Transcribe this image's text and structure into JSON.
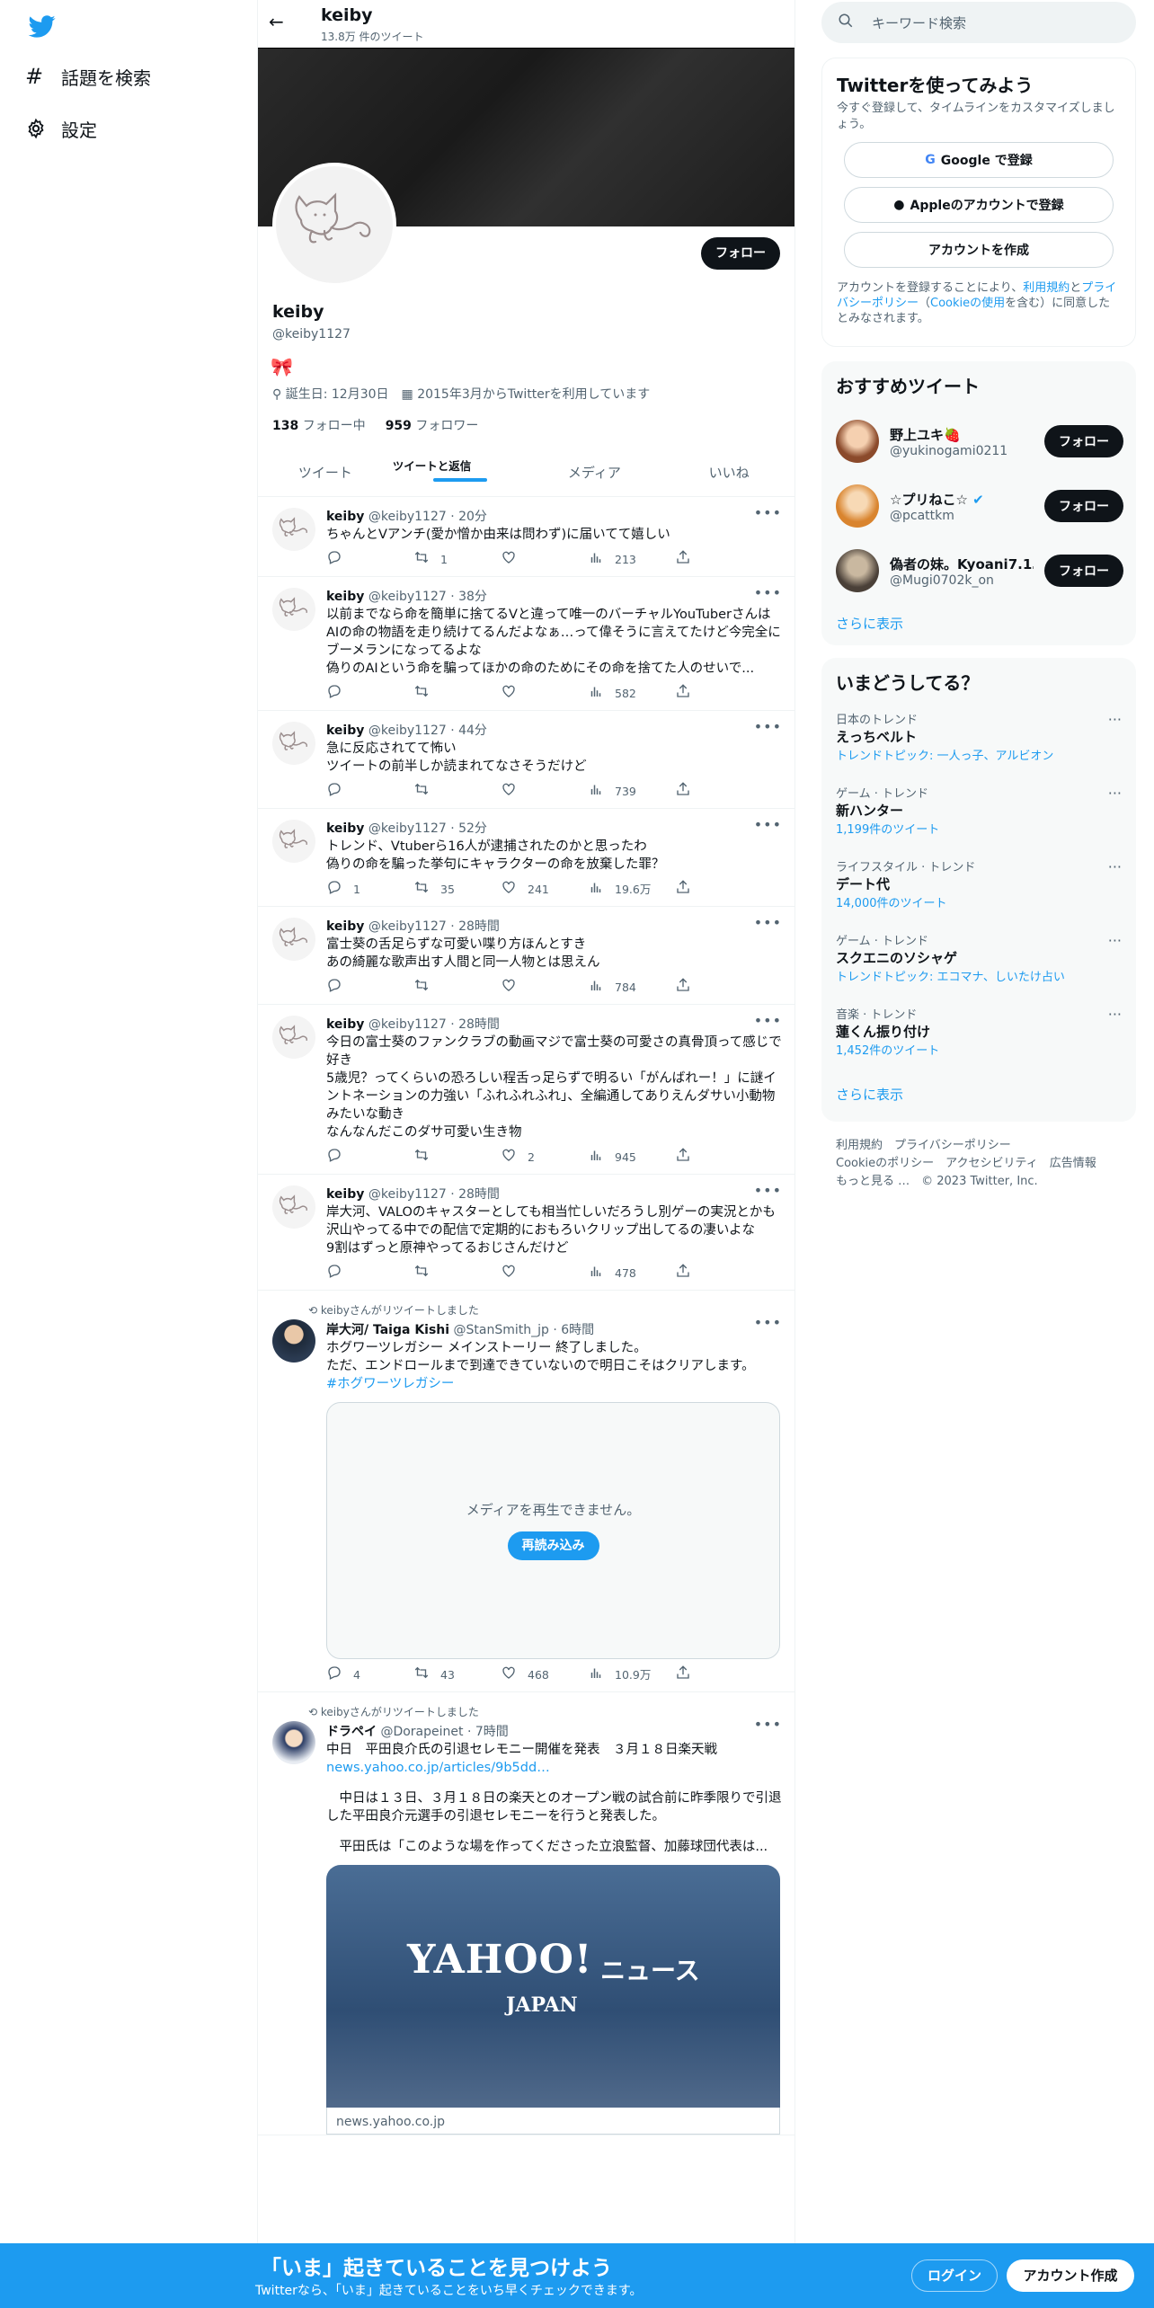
{
  "nav": {
    "explore": "話題を検索",
    "settings": "設定"
  },
  "header": {
    "title": "keiby",
    "tweet_count": "13.8万 件のツイート"
  },
  "profile": {
    "follow": "フォロー",
    "name": "keiby",
    "handle": "@keiby1127",
    "birthday": "誕生日: 12月30日",
    "joined": "2015年3月からTwitterを利用しています",
    "following_num": "138",
    "following_label": "フォロー中",
    "followers_num": "959",
    "followers_label": "フォロワー"
  },
  "tabs": [
    "ツイート",
    "ツイートと返信",
    "メディア",
    "いいね"
  ],
  "tweets": [
    {
      "name": "keiby",
      "meta": "@keiby1127 · 20分",
      "text": "ちゃんとVアンチ(愛か憎か由来は問わず)に届いてて嬉しい",
      "reply": "",
      "rt": "1",
      "like": "",
      "views": "213"
    },
    {
      "name": "keiby",
      "meta": "@keiby1127 · 38分",
      "text": "以前までなら命を簡単に捨てるVと違って唯一のバーチャルYouTuberさんはAIの命の物語を走り続けてるんだよなぁ…って偉そうに言えてたけど今完全にブーメランになってるよな\n偽りのAIという命を騙ってほかの命のためにその命を捨てた人のせいで...",
      "reply": "",
      "rt": "",
      "like": "",
      "views": "582"
    },
    {
      "name": "keiby",
      "meta": "@keiby1127 · 44分",
      "text": "急に反応されてて怖い\nツイートの前半しか読まれてなさそうだけど",
      "reply": "",
      "rt": "",
      "like": "",
      "views": "739"
    },
    {
      "name": "keiby",
      "meta": "@keiby1127 · 52分",
      "text": "トレンド、Vtuberら16人が逮捕されたのかと思ったわ\n偽りの命を騙った挙句にキャラクターの命を放棄した罪？",
      "reply": "1",
      "rt": "35",
      "like": "241",
      "views": "19.6万"
    },
    {
      "name": "keiby",
      "meta": "@keiby1127 · 28時間",
      "text": "富士葵の舌足らずな可愛い喋り方ほんとすき\nあの綺麗な歌声出す人間と同一人物とは思えん",
      "reply": "",
      "rt": "",
      "like": "",
      "views": "784"
    },
    {
      "name": "keiby",
      "meta": "@keiby1127 · 28時間",
      "text": "今日の富士葵のファンクラブの動画マジで富士葵の可愛さの真骨頂って感じで好き\n5歳児？ってくらいの恐ろしい程舌っ足らずで明るい「がんばれー！」に謎イントネーションの力強い「ふれふれふれ」、全編通してありえんダサい小動物みたいな動き\nなんなんだこのダサ可愛い生き物",
      "reply": "",
      "rt": "",
      "like": "2",
      "views": "945"
    },
    {
      "name": "keiby",
      "meta": "@keiby1127 · 28時間",
      "text": "岸大河、VALOのキャスターとしても相当忙しいだろうし別ゲーの実況とかも沢山やってる中での配信で定期的におもろいクリップ出してるの凄いよな\n9割はずっと原神やってるおじさんだけど",
      "reply": "",
      "rt": "",
      "like": "",
      "views": "478"
    }
  ],
  "rt1": {
    "banner": "keibyさんがリツイートしました",
    "name": "岸大河/ Taiga Kishi",
    "meta": "@StanSmith_jp · 6時間",
    "text": "ホグワーツレガシー メインストーリー 終了しました。\nただ、エンドロールまで到達できていないので明日こそはクリアします。",
    "hashtag": "#ホグワーツレガシー",
    "media_msg": "メディアを再生できません。",
    "reload": "再読み込み",
    "reply": "4",
    "rt": "43",
    "like": "468",
    "views": "10.9万"
  },
  "rt2": {
    "banner": "keibyさんがリツイートしました",
    "name": "ドラペイ",
    "meta": "@Dorapeinet · 7時間",
    "line1": "中日　平田良介氏の引退セレモニー開催を発表　３月１８日楽天戦",
    "link": "news.yahoo.co.jp/articles/9b5dd…",
    "para1": "　中日は１３日、３月１８日の楽天とのオープン戦の試合前に昨季限りで引退した平田良介元選手の引退セレモニーを行うと発表した。",
    "para2": "　平田氏は「このような場を作ってくださった立浪監督、加藤球団代表は...",
    "card_logo": "YAHOO!",
    "card_news": "ニュース",
    "card_japan": "JAPAN",
    "card_domain": "news.yahoo.co.jp"
  },
  "search": {
    "placeholder": "キーワード検索"
  },
  "join": {
    "title": "Twitterを使ってみよう",
    "desc": "今すぐ登録して、タイムラインをカスタマイズしましょう。",
    "google": "Google で登録",
    "apple": "Appleのアカウントで登録",
    "create": "アカウントを作成",
    "terms1": "アカウントを登録することにより、",
    "terms_link1": "利用規約",
    "terms2": "と",
    "terms_link2": "プライバシーポリシー",
    "terms3": "（",
    "terms_link3": "Cookieの使用",
    "terms4": "を含む）に同意したとみなされます。"
  },
  "recommend": {
    "title": "おすすめツイート",
    "users": [
      {
        "name": "野上ユキ🍓",
        "handle": "@yukinogami0211"
      },
      {
        "name": "☆プリねこ☆",
        "handle": "@pcattkm"
      },
      {
        "name": "偽者の妹。Kyoani7.1…",
        "handle": "@Mugi0702k_on"
      }
    ],
    "follow": "フォロー",
    "more": "さらに表示"
  },
  "trends": {
    "title": "いまどうしてる？",
    "items": [
      {
        "cat": "日本のトレンド",
        "name": "えっちベルト",
        "sub_pre": "トレンドトピック: ",
        "sub_link": "一人っ子、アルビオン"
      },
      {
        "cat": "ゲーム · トレンド",
        "name": "新ハンター",
        "sub_pre": "1,199件のツイート",
        "sub_link": ""
      },
      {
        "cat": "ライフスタイル · トレンド",
        "name": "デート代",
        "sub_pre": "14,000件のツイート",
        "sub_link": ""
      },
      {
        "cat": "ゲーム · トレンド",
        "name": "スクエニのソシャゲ",
        "sub_pre": "トレンドトピック: ",
        "sub_link": "エコマナ、しいたけ占い"
      },
      {
        "cat": "音楽 · トレンド",
        "name": "蓮くん振り付け",
        "sub_pre": "1,452件のツイート",
        "sub_link": ""
      }
    ],
    "more": "さらに表示"
  },
  "footer": {
    "l1": "利用規約　プライバシーポリシー",
    "l2": "Cookieのポリシー　アクセシビリティ　広告情報",
    "l3": "もっと見る …　© 2023 Twitter, Inc."
  },
  "bottom": {
    "title": "「いま」起きていることを見つけよう",
    "sub": "Twitterなら、「いま」起きていることをいち早くチェックできます。",
    "login": "ログイン",
    "signup": "アカウント作成"
  },
  "colors": {
    "accent": "#1d9bf0",
    "dark": "#0f1419",
    "muted": "#536471"
  }
}
